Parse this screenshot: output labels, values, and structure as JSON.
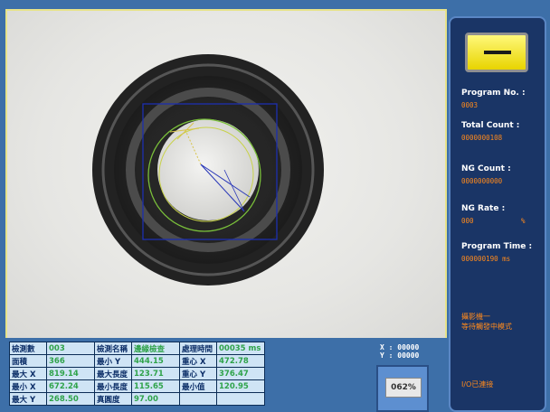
{
  "table": {
    "rows": [
      [
        {
          "label": "檢測數",
          "value": "003"
        },
        {
          "label": "檢測名稱",
          "value": "邊緣檢查"
        },
        {
          "label": "處理時間",
          "value": "00035 ms"
        }
      ],
      [
        {
          "label": "面積",
          "value": "366"
        },
        {
          "label": "最小 Y",
          "value": "444.15"
        },
        {
          "label": "重心 X",
          "value": "472.78"
        }
      ],
      [
        {
          "label": "最大 X",
          "value": "819.14"
        },
        {
          "label": "最大長度",
          "value": "123.71"
        },
        {
          "label": "重心 Y",
          "value": "376.47"
        }
      ],
      [
        {
          "label": "最小 X",
          "value": "672.24"
        },
        {
          "label": "最小長度",
          "value": "115.65"
        },
        {
          "label": "最小值",
          "value": "120.95"
        }
      ],
      [
        {
          "label": "最大 Y",
          "value": "268.50"
        },
        {
          "label": "真圓度",
          "value": "97.00"
        },
        {
          "label": "",
          "value": ""
        }
      ]
    ]
  },
  "coords": {
    "x": "X : 00000",
    "y": "Y : 00000"
  },
  "percent_button": "062%",
  "side_panel": {
    "program_no_label": "Program No. :",
    "program_no_value": "0003",
    "total_count_label": "Total Count :",
    "total_count_value": "0000000108",
    "ng_count_label": "NG Count :",
    "ng_count_value": "0000000000",
    "ng_rate_label": "NG Rate :",
    "ng_rate_value": "000",
    "ng_rate_unit": "%",
    "program_time_label": "Program Time :",
    "program_time_value": "000000190 ms",
    "mode_line1": "攝影機一",
    "mode_line2": "等待觸發中模式",
    "io_status": "I/O已連接"
  },
  "colors": {
    "background": "#3d6fa8",
    "panel": "#1a3566",
    "label_text": "#ffffff",
    "value_text": "#ff8a1c",
    "table_value": "#2fa34a",
    "status_lamp": "#f2e600"
  }
}
